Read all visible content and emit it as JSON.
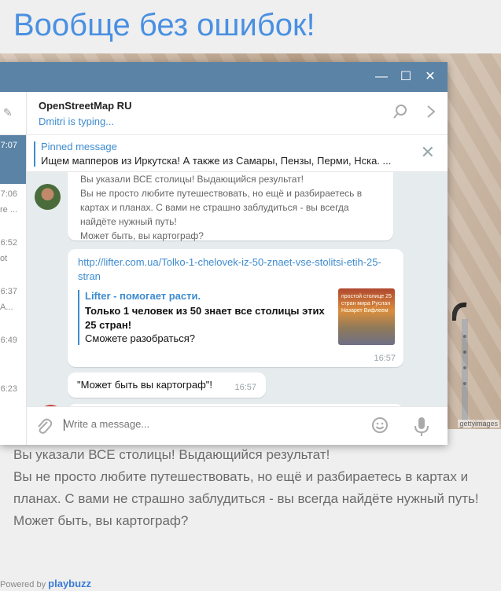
{
  "page": {
    "title": "Вообще без ошибок!"
  },
  "photo": {
    "credit": "gettyimages"
  },
  "window": {
    "minimize": "—",
    "maximize": "☐",
    "close": "✕"
  },
  "sidebar": {
    "rows": [
      {
        "time": "7:07",
        "snippet": ""
      },
      {
        "time": "7:06",
        "snippet": "re ..."
      },
      {
        "time": "6:52",
        "snippet": "ot"
      },
      {
        "time": "6:37",
        "snippet": "A..."
      },
      {
        "time": "6:49",
        "snippet": ""
      },
      {
        "time": "6:23",
        "snippet": ""
      }
    ]
  },
  "chat": {
    "name": "OpenStreetMap RU",
    "status": "Dmitri is typing..."
  },
  "pinned": {
    "title": "Pinned message",
    "text": "Ищем мапперов из Иркутска! А также из Самары, Пензы, Перми, Нска. ..."
  },
  "messages": {
    "quote_lines": [
      "Вы указали ВСЕ столицы! Выдающийся результат!",
      "Вы не просто любите путешествовать, но ещё и разбираетесь в картах и планах. С вами не страшно заблудиться - вы всегда найдёте нужный путь!",
      "Может быть, вы картограф?"
    ],
    "link_message": {
      "url": "http://lifter.com.ua/Tolko-1-chelovek-iz-50-znaet-vse-stolitsi-etih-25-stran",
      "site": "Lifter - помогает расти.",
      "title": "Только 1 человек из 50 знает все столицы этих 25 стран!",
      "description": "Сможете разобраться?",
      "thumb_text": "простой столице 25 стран мира Руслан Назарет Вифлеем",
      "time": "16:57"
    },
    "short_message": {
      "text": "\"Может быть вы картограф\"!",
      "time": "16:57"
    }
  },
  "composer": {
    "placeholder": "Write a message..."
  },
  "caption": {
    "lines": [
      "Вы указали ВСЕ столицы! Выдающийся результат!",
      "Вы не просто любите путешествовать, но ещё и разбираетесь в картах и планах. С вами не страшно заблудиться - вы всегда найдёте нужный путь!",
      "Может быть, вы картограф?"
    ]
  },
  "footer": {
    "powered_by": "Powered by",
    "brand": "playbuzz"
  },
  "colors": {
    "title_blue": "#4a90e2",
    "telegram_header": "#5b83a5",
    "link_blue": "#3d8bd0"
  }
}
